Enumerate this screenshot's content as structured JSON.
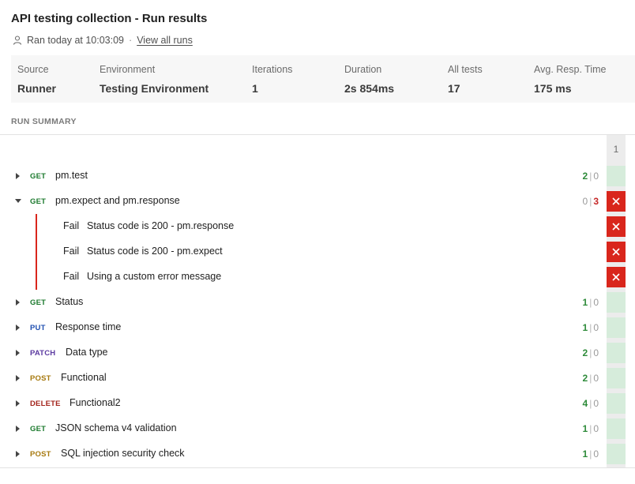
{
  "header": {
    "title": "API testing collection - Run results",
    "ran_text": "Ran today at 10:03:09",
    "separator": "·",
    "view_all_runs": "View all runs"
  },
  "stats": [
    {
      "label": "Source",
      "value": "Runner"
    },
    {
      "label": "Environment",
      "value": "Testing Environment"
    },
    {
      "label": "Iterations",
      "value": "1"
    },
    {
      "label": "Duration",
      "value": "2s 854ms"
    },
    {
      "label": "All tests",
      "value": "17"
    },
    {
      "label": "Avg. Resp. Time",
      "value": "175 ms"
    }
  ],
  "summary": {
    "section_label": "RUN SUMMARY",
    "iteration_header": "1",
    "count_separator": "|",
    "fail_label": "Fail"
  },
  "requests": [
    {
      "method": "GET",
      "name": "pm.test",
      "passed": "2",
      "failed": "0",
      "expanded": false,
      "status": "pass"
    },
    {
      "method": "GET",
      "name": "pm.expect and pm.response",
      "passed": "0",
      "failed": "3",
      "expanded": true,
      "status": "fail",
      "failures": [
        "Status code is 200 - pm.response",
        "Status code is 200 - pm.expect",
        "Using a custom error message"
      ]
    },
    {
      "method": "GET",
      "name": "Status",
      "passed": "1",
      "failed": "0",
      "expanded": false,
      "status": "pass"
    },
    {
      "method": "PUT",
      "name": "Response time",
      "passed": "1",
      "failed": "0",
      "expanded": false,
      "status": "pass"
    },
    {
      "method": "PATCH",
      "name": "Data type",
      "passed": "2",
      "failed": "0",
      "expanded": false,
      "status": "pass"
    },
    {
      "method": "POST",
      "name": "Functional",
      "passed": "2",
      "failed": "0",
      "expanded": false,
      "status": "pass"
    },
    {
      "method": "DELETE",
      "name": "Functional2",
      "passed": "4",
      "failed": "0",
      "expanded": false,
      "status": "pass"
    },
    {
      "method": "GET",
      "name": "JSON schema v4 validation",
      "passed": "1",
      "failed": "0",
      "expanded": false,
      "status": "pass"
    },
    {
      "method": "POST",
      "name": "SQL injection security check",
      "passed": "1",
      "failed": "0",
      "expanded": false,
      "status": "pass"
    }
  ],
  "icons": {
    "user": "user-icon",
    "caret_right": "caret-right-icon",
    "caret_down": "caret-down-icon",
    "fail_cell": "close-icon"
  },
  "colors": {
    "pass": "#2e8b3a",
    "fail": "#c62828",
    "fail_cell": "#d9261c",
    "pass_cell": "#d6ecdb"
  }
}
